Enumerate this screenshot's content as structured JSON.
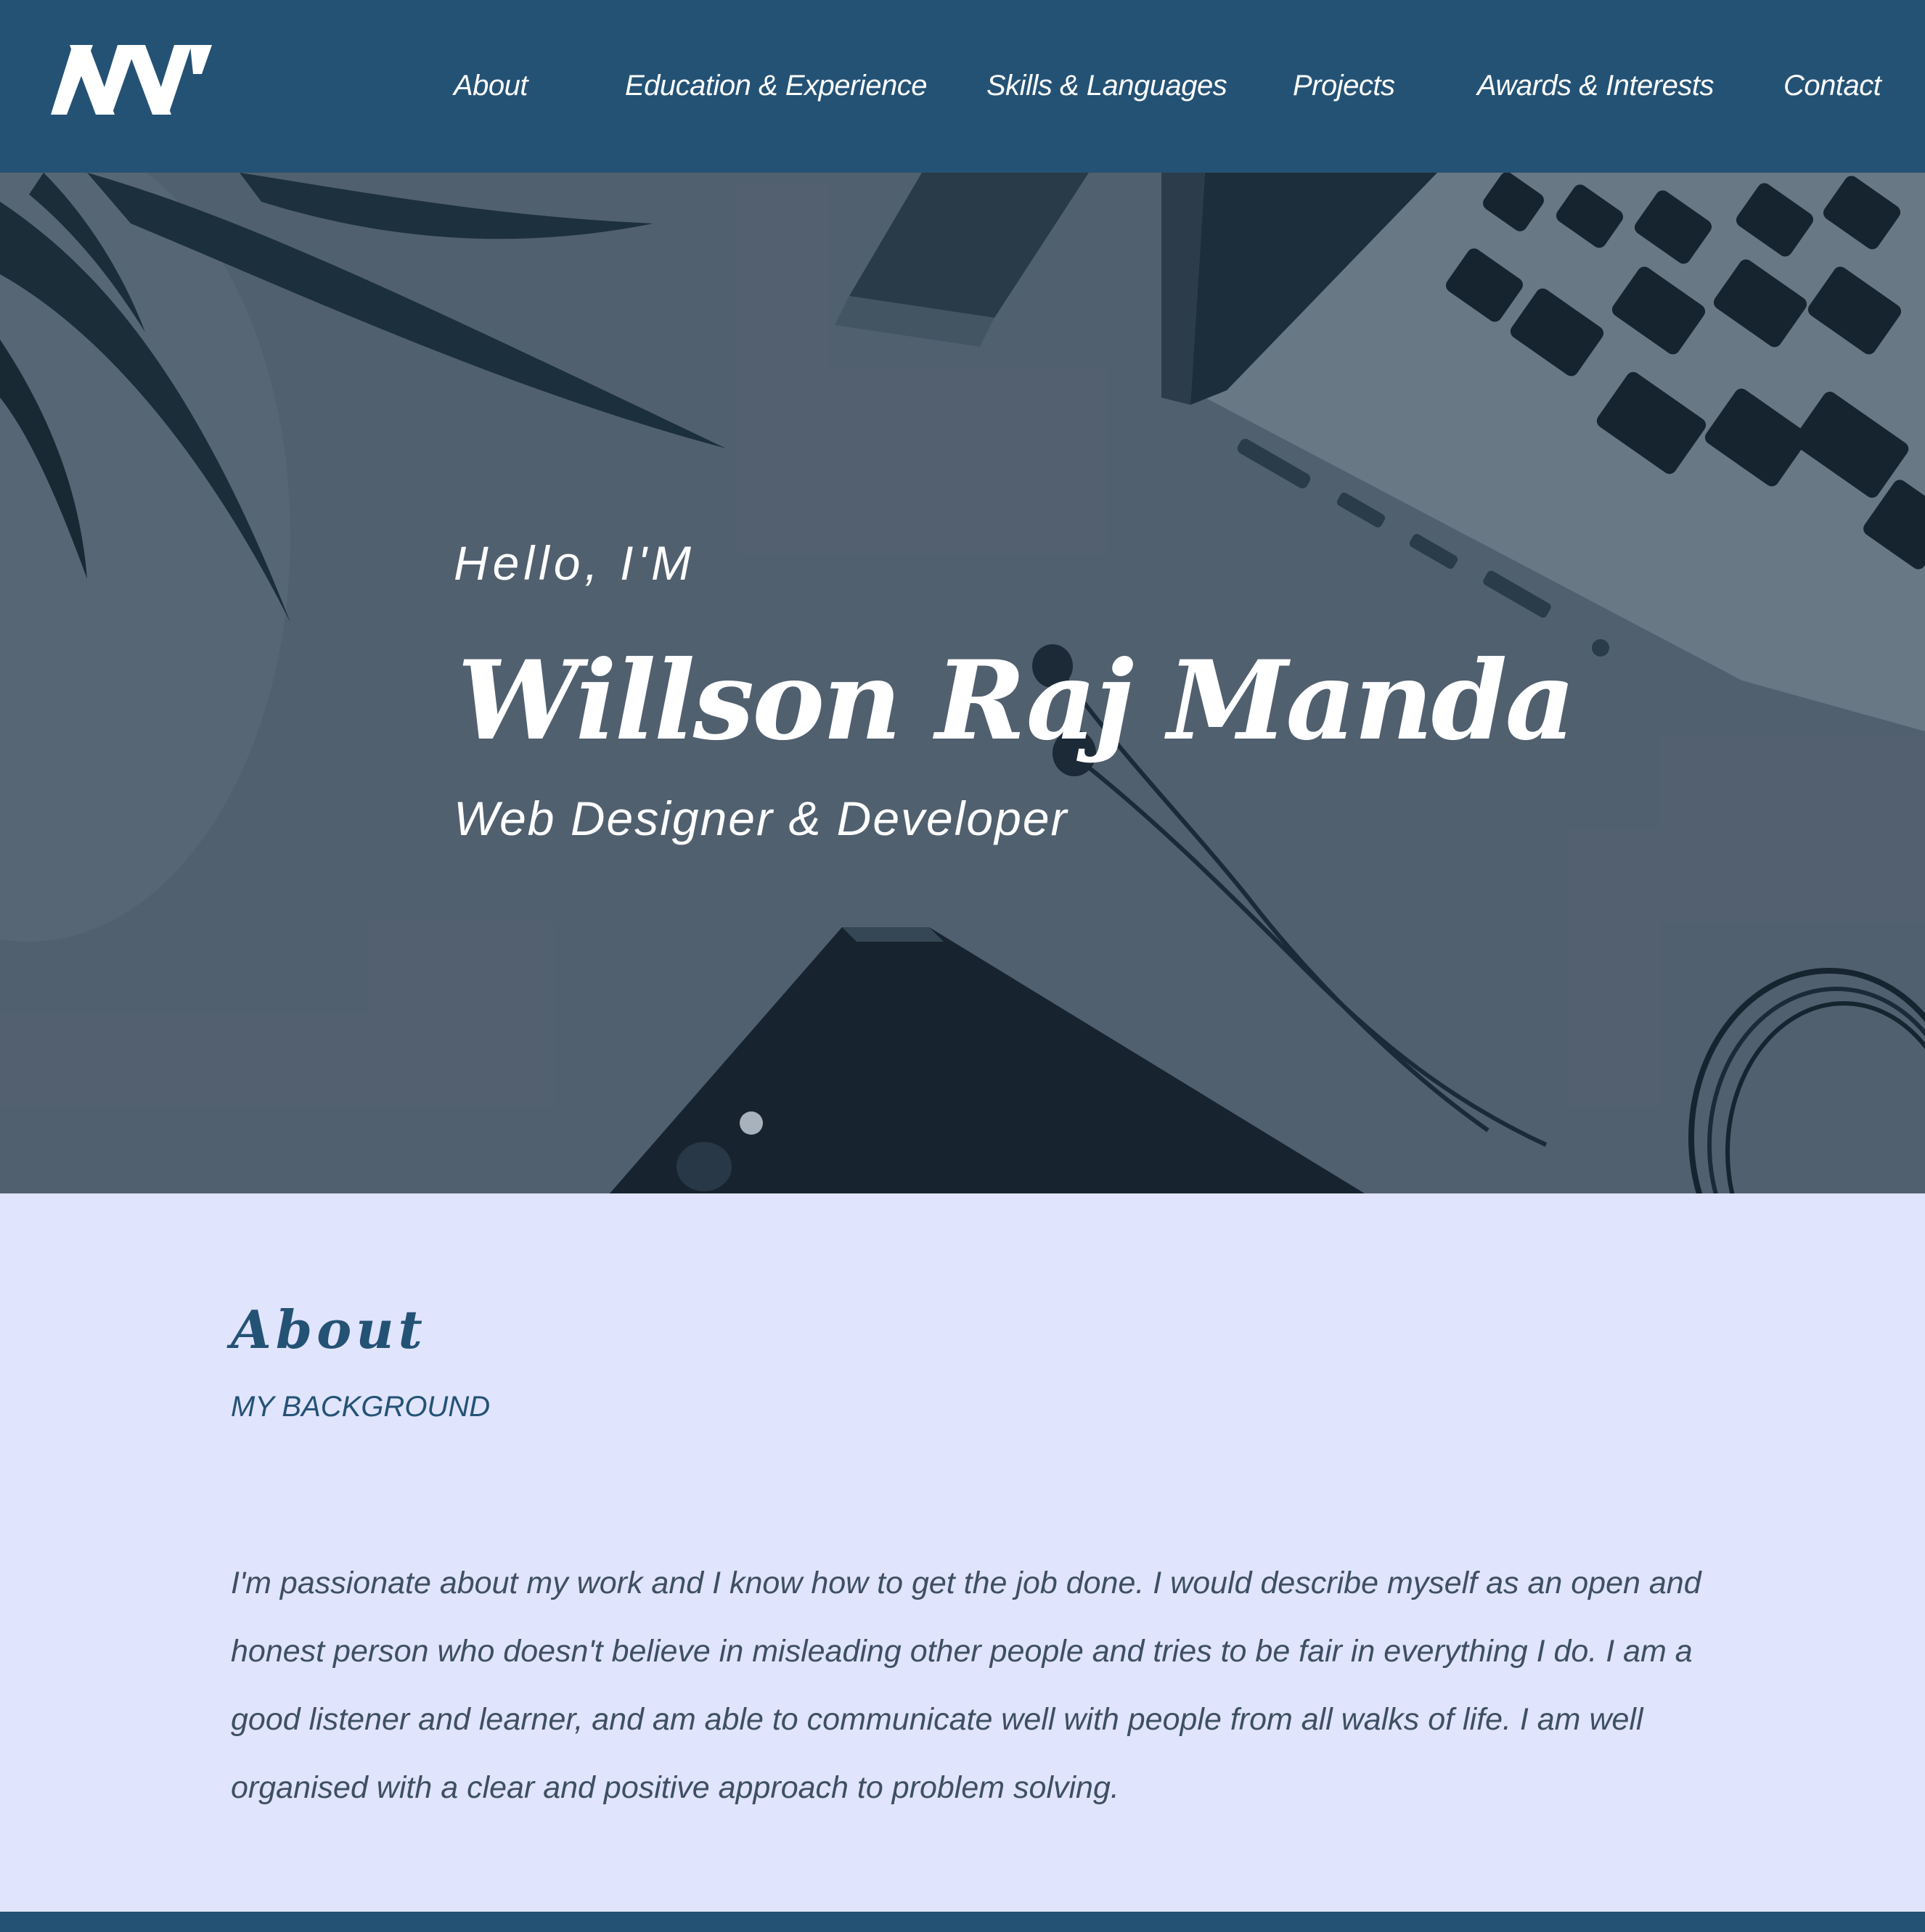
{
  "colors": {
    "primary": "#245275",
    "background": "#e0e4fd",
    "body_text": "#3e4f63",
    "on_primary": "#ffffff"
  },
  "header": {
    "logo_icon": "mw-monogram-logo",
    "logo_text": "MW",
    "nav": {
      "about": "About",
      "education": "Education & Experience",
      "skills": "Skills & Languages",
      "projects": "Projects",
      "awards": "Awards & Interests",
      "contact": "Contact"
    }
  },
  "hero": {
    "greeting": "Hello, I'M",
    "name": "Willson Raj Manda",
    "role": "Web Designer & Developer"
  },
  "about": {
    "title": "About",
    "subtitle": "MY BACKGROUND",
    "text": "I'm passionate about my work and I know how to get the job done. I would describe myself as an open and honest person who doesn't believe in misleading other people and tries to be fair in everything I do. I am a good listener and learner, and am able to communicate well with people from all walks of life. I am well organised with a clear and positive approach to problem solving."
  }
}
